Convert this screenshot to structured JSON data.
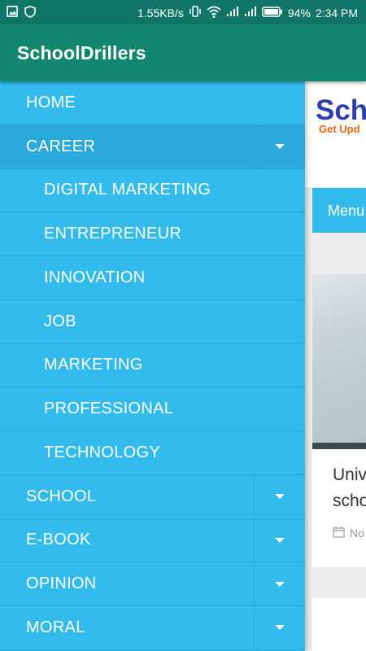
{
  "status_bar": {
    "speed": "1.55KB/s",
    "battery": "94%",
    "time": "2:34 PM",
    "icons": [
      "image-icon",
      "shield-icon",
      "vibrate-icon",
      "wifi-icon",
      "signal-icon",
      "signal-icon-2",
      "battery-icon"
    ]
  },
  "app_bar": {
    "title": "SchoolDrillers"
  },
  "drawer": {
    "home": "HOME",
    "career": "CAREER",
    "career_sub": [
      "DIGITAL MARKETING",
      "ENTREPRENEUR",
      "INNOVATION",
      "JOB",
      "MARKETING",
      "PROFESSIONAL",
      "TECHNOLOGY"
    ],
    "school": "SCHOOL",
    "ebook": "E-BOOK",
    "opinion": "OPINION",
    "moral": "MORAL"
  },
  "background_page": {
    "logo_text": "Sch",
    "logo_tagline": "Get Upd",
    "menu_label": "Menu",
    "card_title_line1": "Univ",
    "card_title_line2": "scho",
    "card_date": "No"
  },
  "colors": {
    "status_bar": "#0f7566",
    "app_bar": "#13866f",
    "drawer": "#33bbee",
    "drawer_active": "#2ba9dc"
  }
}
